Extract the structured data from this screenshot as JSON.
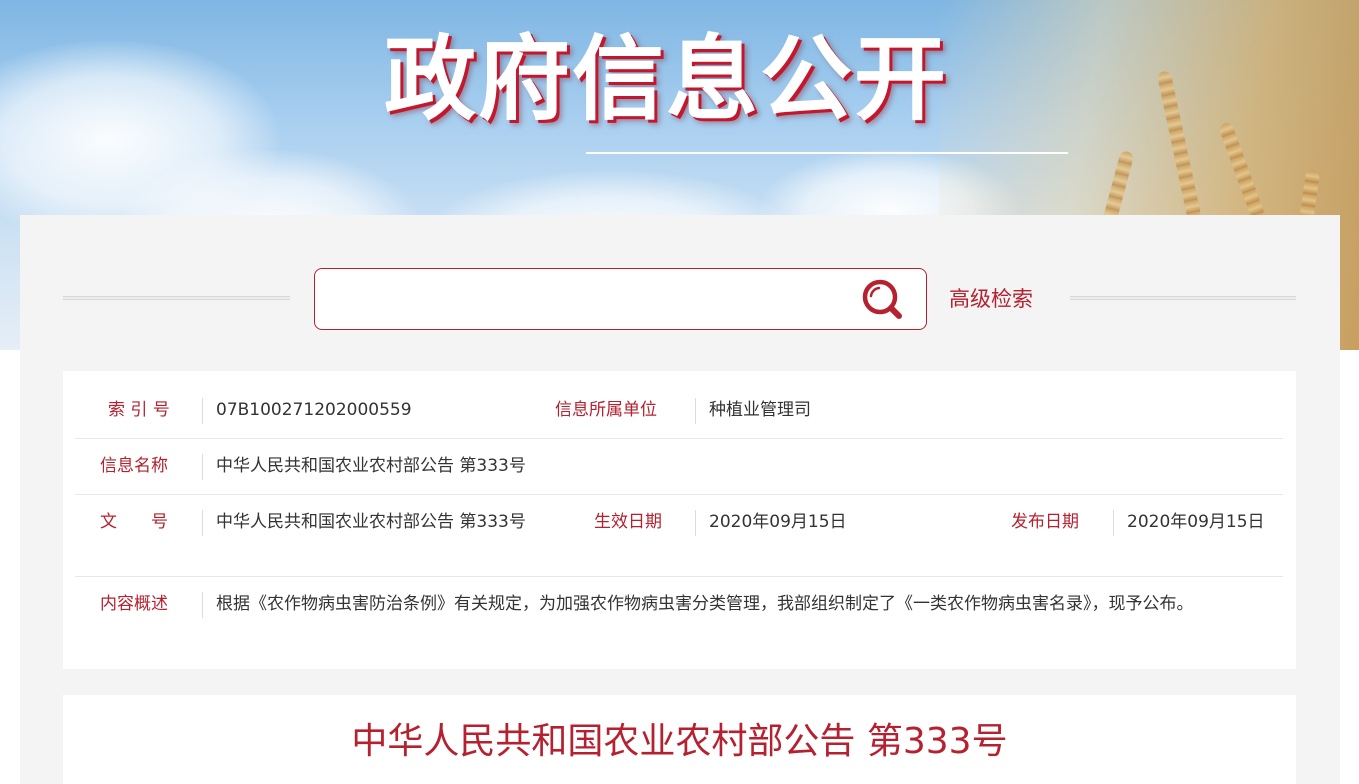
{
  "banner": {
    "title": "政府信息公开"
  },
  "search": {
    "value": "",
    "placeholder": "",
    "advanced_label": "高级检索"
  },
  "info": {
    "index_label": "索 引 号",
    "index_value": "07B100271202000559",
    "unit_label": "信息所属单位",
    "unit_value": "种植业管理司",
    "name_label": "信息名称",
    "name_value": "中华人民共和国农业农村部公告 第333号",
    "doc_label": "文　　号",
    "doc_value": "中华人民共和国农业农村部公告 第333号",
    "effective_label": "生效日期",
    "effective_value": "2020年09月15日",
    "publish_label": "发布日期",
    "publish_value": "2020年09月15日",
    "summary_label": "内容概述",
    "summary_value": "根据《农作物病虫害防治条例》有关规定，为加强农作物病虫害分类管理，我部组织制定了《一类农作物病虫害名录》，现予公布。"
  },
  "article": {
    "title": "中华人民共和国农业农村部公告 第333号"
  },
  "colors": {
    "accent": "#b5212f",
    "panel_bg": "#f4f4f4",
    "text": "#333333"
  }
}
